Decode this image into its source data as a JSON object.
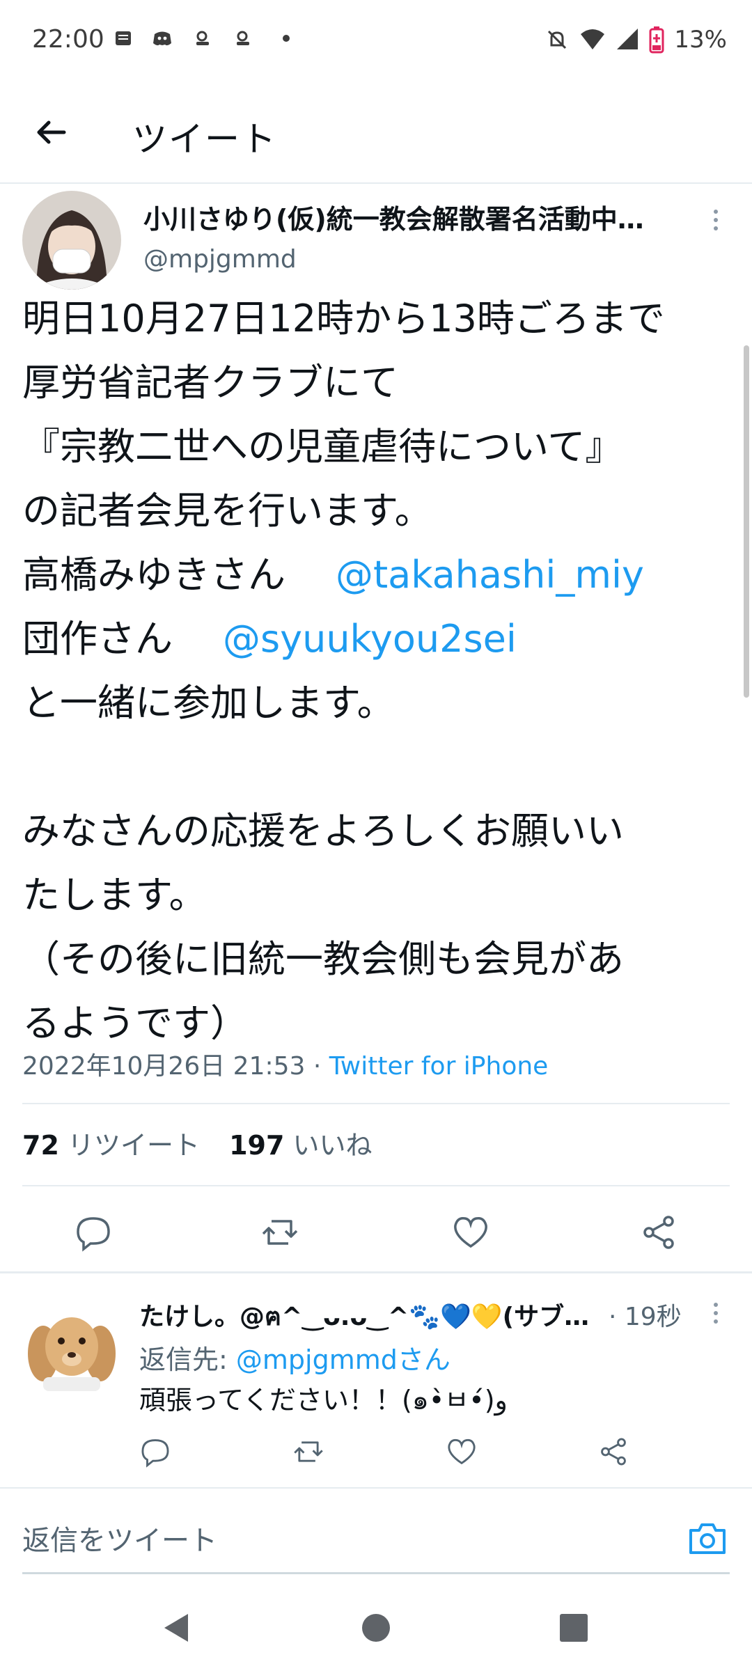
{
  "status_bar": {
    "time": "22:00",
    "battery": "13%",
    "icons": [
      "notification-icon",
      "discord-icon",
      "app-icon",
      "app-icon",
      "dot-icon",
      "mute-icon",
      "wifi-icon",
      "signal-icon",
      "battery-icon"
    ]
  },
  "header": {
    "title": "ツイート"
  },
  "tweet": {
    "author_name": "小川さゆり(仮)統一教会解散署名活動中…",
    "author_handle": "@mpjgmmd",
    "lines": [
      "明日10月27日12時から13時ごろまで",
      "厚労省記者クラブにて",
      "『宗教二世への児童虐待について』",
      "の記者会見を行います。",
      "高橋みゆきさん　",
      "団作さん　",
      "と一緒に参加します。",
      "",
      "みなさんの応援をよろしくお願いい",
      "たします。",
      "（その後に旧統一教会側も会見があ",
      "るようです）"
    ],
    "mention_1": "@takahashi_miy",
    "mention_2": "@syuukyou2sei",
    "timestamp": "2022年10月26日 21:53 · ",
    "source": "Twitter for iPhone",
    "retweet_count": "72",
    "retweet_label": "リツイート",
    "like_count": "197",
    "like_label": "いいね"
  },
  "reply": {
    "author_name": "たけし。@ฅ^‿ᴗ.ᴗ‿^🐾💙💛(サブ…",
    "time": "· 19秒",
    "reply_to_label": "返信先: ",
    "reply_to_mention": "@mpjgmmdさん",
    "text": "頑張ってください！！(๑•̀ㅂ•́)و"
  },
  "compose": {
    "placeholder": "返信をツイート"
  },
  "colors": {
    "accent": "#1d9bf0",
    "text": "#0f1419",
    "secondary": "#536471",
    "battery_low": "#e0245e"
  }
}
